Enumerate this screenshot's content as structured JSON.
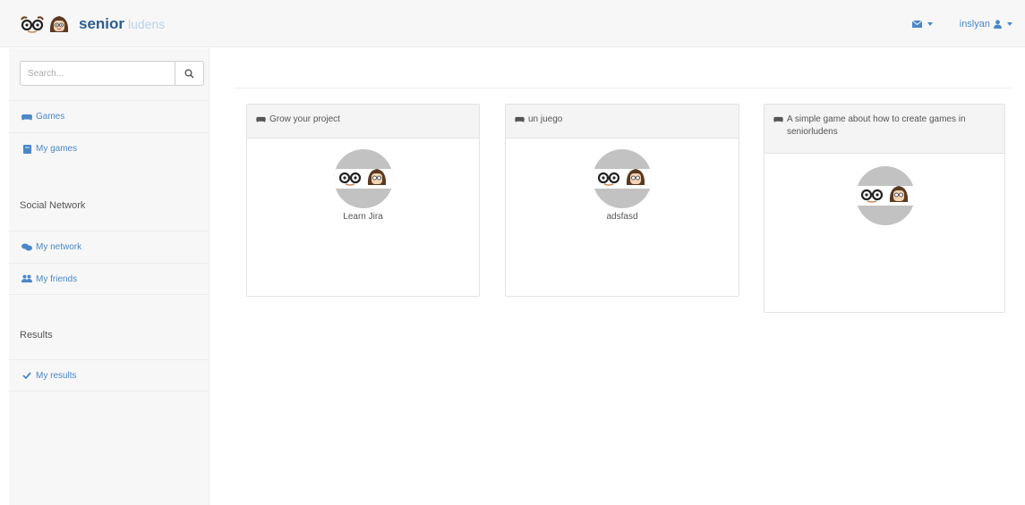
{
  "navbar": {
    "brand_primary": "senior",
    "brand_secondary": "ludens",
    "user_label": "inslyan",
    "icons": [
      "glasses-logo-icon",
      "face-logo-icon",
      "envelope-icon",
      "user-icon",
      "caret-down-icon"
    ]
  },
  "sidebar": {
    "search": {
      "placeholder": "Search..."
    },
    "games_items": [
      {
        "label": "Games",
        "icon": "gamepad-icon"
      },
      {
        "label": "My games",
        "icon": "book-icon"
      }
    ],
    "social_header": "Social Network",
    "social_items": [
      {
        "label": "My network",
        "icon": "comments-icon"
      },
      {
        "label": "My friends",
        "icon": "users-icon"
      }
    ],
    "results_header": "Results",
    "results_items": [
      {
        "label": "My results",
        "icon": "check-icon"
      }
    ]
  },
  "cards": [
    {
      "title": "Grow your project",
      "author": "Learn Jira"
    },
    {
      "title": "un juego",
      "author": "adsfasd"
    },
    {
      "title": "A simple game about how to create games in seniorludens",
      "author": ""
    }
  ],
  "colors": {
    "brand_dark": "#2a5d8f",
    "brand_light": "#bcd2e8",
    "link": "#4a88c7",
    "sidebar_bg": "#f7f7f7",
    "card_head_bg": "#f4f4f4",
    "avatar_bg": "#c2c2c2"
  }
}
